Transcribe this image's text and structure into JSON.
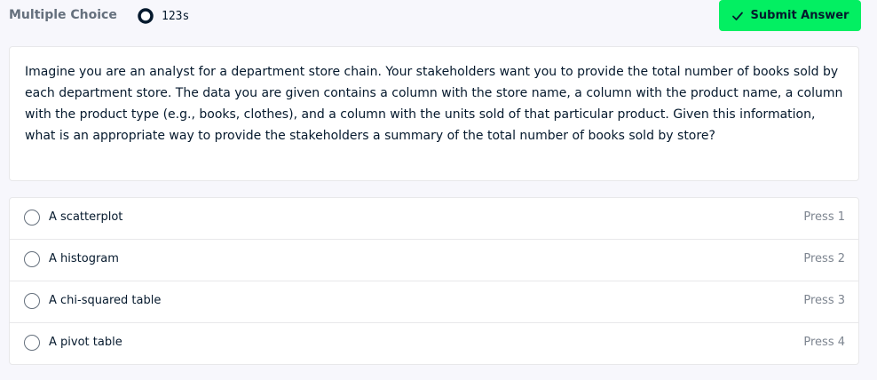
{
  "header": {
    "title": "Multiple Choice",
    "timer": "123s",
    "timer_icon": "progress-ring-icon"
  },
  "submit": {
    "label": "Submit Answer",
    "icon": "check-icon",
    "color": "#03ef62"
  },
  "question": {
    "text": "Imagine you are an analyst for a department store chain. Your stakeholders want you to provide the total number of books sold by each department store. The data you are given contains a column with the store name, a column with the product name, a column with the product type (e.g., books, clothes), and a column with the units sold of that particular product. Given this information, what is an appropriate way to provide the stakeholders a summary of the total number of books sold by store?"
  },
  "options": [
    {
      "label": "A scatterplot",
      "key": "Press 1"
    },
    {
      "label": "A histogram",
      "key": "Press 2"
    },
    {
      "label": "A chi-squared table",
      "key": "Press 3"
    },
    {
      "label": "A pivot table",
      "key": "Press 4"
    }
  ]
}
